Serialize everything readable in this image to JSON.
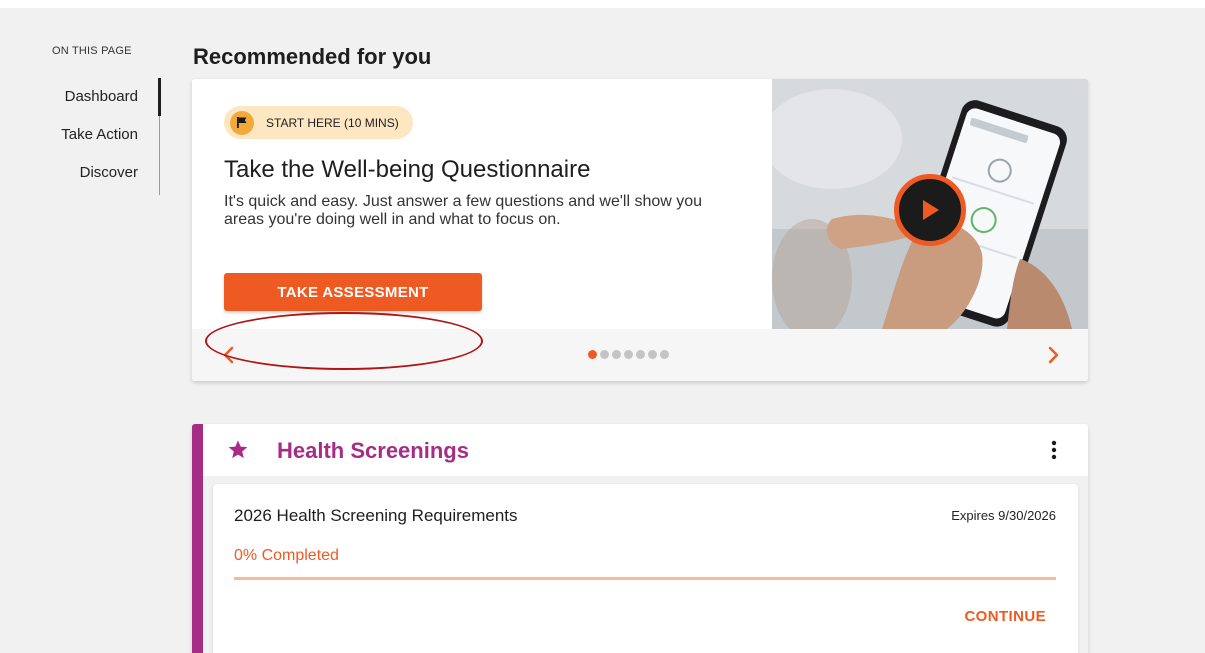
{
  "toc": {
    "heading": "ON THIS PAGE",
    "items": [
      {
        "label": "Dashboard",
        "active": true
      },
      {
        "label": "Take Action",
        "active": false
      },
      {
        "label": "Discover",
        "active": false
      }
    ]
  },
  "recommended": {
    "section_title": "Recommended for you",
    "slide": {
      "badge_icon": "flag-icon",
      "badge_label": "START HERE (10 MINS)",
      "title": "Take the Well-being Questionnaire",
      "description": "It's quick and easy. Just answer a few questions and we'll show you areas you're doing well in and what to focus on.",
      "cta_label": "TAKE ASSESSMENT",
      "media_icon": "play-icon"
    },
    "pagination": {
      "total": 7,
      "active_index": 0
    },
    "prev_icon": "chevron-left-icon",
    "next_icon": "chevron-right-icon"
  },
  "health_screenings": {
    "title": "Health Screenings",
    "title_icon": "star-icon",
    "menu_icon": "more-vertical-icon",
    "requirement": {
      "title": "2026 Health Screening Requirements",
      "expires": "Expires 9/30/2026",
      "progress_text": "0% Completed",
      "progress": 0,
      "action_label": "CONTINUE"
    }
  },
  "colors": {
    "accent": "#ef5a22",
    "badge_bg": "#fde7c2",
    "screenings_brand": "#a62d86",
    "progress_track": "#f8b99c",
    "annotation": "#b01515"
  }
}
